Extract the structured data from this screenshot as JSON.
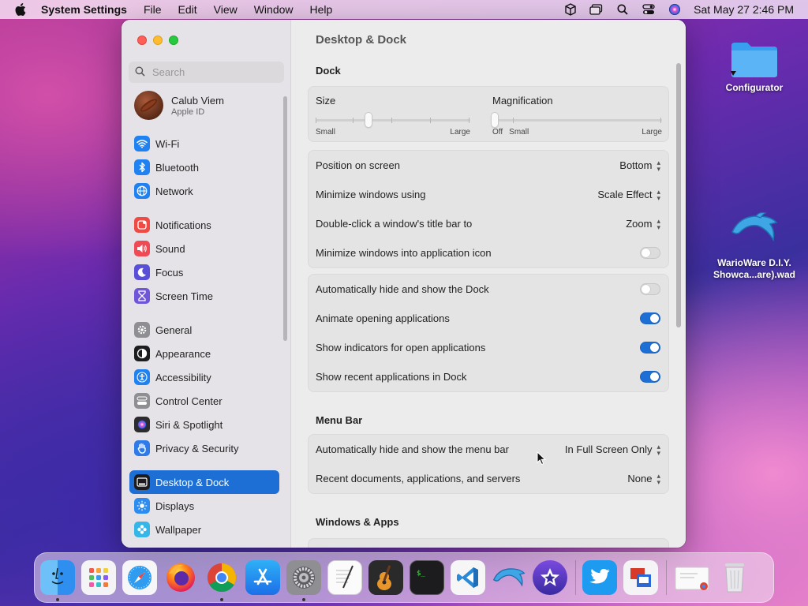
{
  "menubar": {
    "app_name": "System Settings",
    "menus": [
      "File",
      "Edit",
      "View",
      "Window",
      "Help"
    ],
    "clock": "Sat May 27  2:46 PM",
    "status_icons": [
      "box-icon",
      "window-stack-icon",
      "search-icon",
      "control-center-icon",
      "siri-icon"
    ]
  },
  "sidebar": {
    "search_placeholder": "Search",
    "account": {
      "name": "Calub Viem",
      "subtitle": "Apple ID"
    },
    "items": [
      {
        "label": "Wi-Fi",
        "icon": "wifi-icon",
        "color": "#1f82f0"
      },
      {
        "label": "Bluetooth",
        "icon": "bluetooth-icon",
        "color": "#1f82f0"
      },
      {
        "label": "Network",
        "icon": "globe-icon",
        "color": "#1f82f0"
      },
      {
        "label": "Notifications",
        "icon": "bell-icon",
        "color": "#f04a45"
      },
      {
        "label": "Sound",
        "icon": "speaker-icon",
        "color": "#f04a55"
      },
      {
        "label": "Focus",
        "icon": "moon-icon",
        "color": "#5a4fd8"
      },
      {
        "label": "Screen Time",
        "icon": "hourglass-icon",
        "color": "#6f56d8"
      },
      {
        "label": "General",
        "icon": "gear-icon",
        "color": "#8e8e93"
      },
      {
        "label": "Appearance",
        "icon": "appearance-icon",
        "color": "#1c1c1e"
      },
      {
        "label": "Accessibility",
        "icon": "accessibility-icon",
        "color": "#1f82f0"
      },
      {
        "label": "Control Center",
        "icon": "control-center-icon",
        "color": "#8e8e93"
      },
      {
        "label": "Siri & Spotlight",
        "icon": "siri-icon",
        "color": "#2c2c2e"
      },
      {
        "label": "Privacy & Security",
        "icon": "hand-icon",
        "color": "#2d7ae8"
      },
      {
        "label": "Desktop & Dock",
        "icon": "dock-icon",
        "color": "#1c1c1e"
      },
      {
        "label": "Displays",
        "icon": "sun-icon",
        "color": "#2d8cf0"
      },
      {
        "label": "Wallpaper",
        "icon": "flower-icon",
        "color": "#35b6e8"
      }
    ],
    "active_item": "Desktop & Dock"
  },
  "main": {
    "title": "Desktop & Dock",
    "dock_section": "Dock",
    "size": {
      "label": "Size",
      "min_label": "Small",
      "max_label": "Large",
      "value": 0.34
    },
    "magnification": {
      "label": "Magnification",
      "off_label": "Off",
      "min_label": "Small",
      "max_label": "Large",
      "value": 0.0
    },
    "rows1": [
      {
        "label": "Position on screen",
        "value": "Bottom"
      },
      {
        "label": "Minimize windows using",
        "value": "Scale Effect"
      },
      {
        "label": "Double-click a window's title bar to",
        "value": "Zoom"
      },
      {
        "label": "Minimize windows into application icon",
        "toggle": false
      }
    ],
    "rows2": [
      {
        "label": "Automatically hide and show the Dock",
        "toggle": false
      },
      {
        "label": "Animate opening applications",
        "toggle": true
      },
      {
        "label": "Show indicators for open applications",
        "toggle": true
      },
      {
        "label": "Show recent applications in Dock",
        "toggle": true
      }
    ],
    "menu_bar_section": "Menu Bar",
    "rows3": [
      {
        "label": "Automatically hide and show the menu bar",
        "value": "In Full Screen Only"
      },
      {
        "label": "Recent documents, applications, and servers",
        "value": "None"
      }
    ],
    "windows_section": "Windows & Apps"
  },
  "desktop": {
    "icons": [
      {
        "label": "Configurator",
        "icon": "folder-icon"
      },
      {
        "label_line1": "WarioWare D.I.Y.",
        "label_line2": "Showca...are).wad",
        "icon": "dolphin-icon"
      }
    ]
  },
  "dock": {
    "apps": [
      {
        "name": "finder-icon",
        "running": true
      },
      {
        "name": "launchpad-icon",
        "running": false
      },
      {
        "name": "safari-icon",
        "running": false
      },
      {
        "name": "firefox-icon",
        "running": false
      },
      {
        "name": "chrome-icon",
        "running": true
      },
      {
        "name": "app-store-icon",
        "running": false
      },
      {
        "name": "system-settings-icon",
        "running": true
      },
      {
        "name": "textedit-icon",
        "running": false
      },
      {
        "name": "garageband-icon",
        "running": false
      },
      {
        "name": "terminal-icon",
        "running": false
      },
      {
        "name": "vscode-icon",
        "running": false
      },
      {
        "name": "dolphin-icon",
        "running": false
      },
      {
        "name": "imovie-icon",
        "running": false
      },
      {
        "name": "twitter-icon",
        "running": false
      },
      {
        "name": "remote-desktop-icon",
        "running": false
      },
      {
        "name": "recent-document-icon",
        "running": false
      },
      {
        "name": "trash-icon",
        "running": false
      }
    ]
  }
}
